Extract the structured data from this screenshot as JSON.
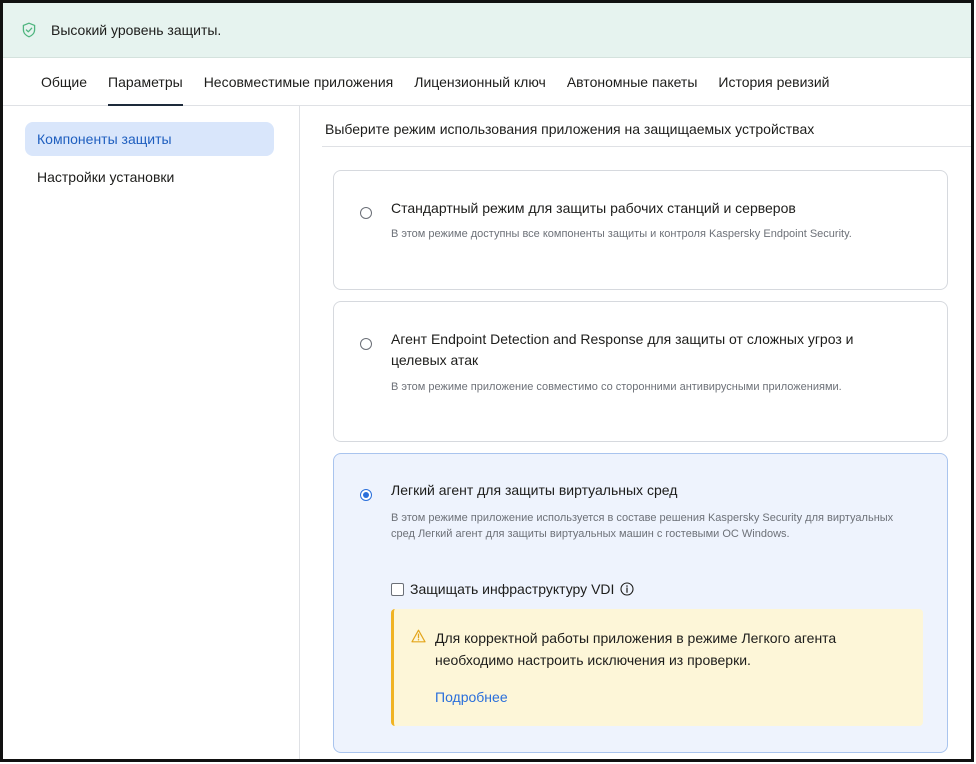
{
  "status": {
    "icon": "shield-check-icon",
    "text": "Высокий уровень защиты."
  },
  "tabs": [
    {
      "label": "Общие",
      "active": false
    },
    {
      "label": "Параметры",
      "active": true
    },
    {
      "label": "Несовместимые приложения",
      "active": false
    },
    {
      "label": "Лицензионный ключ",
      "active": false
    },
    {
      "label": "Автономные пакеты",
      "active": false
    },
    {
      "label": "История ревизий",
      "active": false
    }
  ],
  "sidebar": {
    "items": [
      {
        "label": "Компоненты защиты",
        "active": true
      },
      {
        "label": "Настройки установки",
        "active": false
      }
    ]
  },
  "main": {
    "title": "Выберите режим использования приложения на защищаемых устройствах",
    "modes": [
      {
        "title": "Стандартный режим для защиты рабочих станций и серверов",
        "description": "В этом режиме доступны все компоненты защиты и контроля Kaspersky Endpoint Security.",
        "selected": false
      },
      {
        "title": "Агент Endpoint Detection and Response для защиты от сложных угроз и целевых атак",
        "description": "В этом режиме приложение совместимо со сторонними антивирусными приложениями.",
        "selected": false
      },
      {
        "title": "Легкий агент для защиты виртуальных сред",
        "description": "В этом режиме приложение используется в составе решения Kaspersky Security для виртуальных сред Легкий агент для защиты виртуальных машин с гостевыми ОС Windows.",
        "selected": true,
        "checkbox_label": "Защищать инфраструктуру VDI",
        "checkbox_checked": false,
        "warning_text": "Для корректной работы приложения в режиме Легкого агента необходимо настроить исключения из проверки.",
        "warning_link": "Подробнее"
      }
    ]
  },
  "colors": {
    "accent": "#2a6fdb",
    "status_bg": "#e6f3ef",
    "selected_card_bg": "#eef3fd",
    "warning_bg": "#fdf6d8",
    "warning_accent": "#f0b323"
  }
}
